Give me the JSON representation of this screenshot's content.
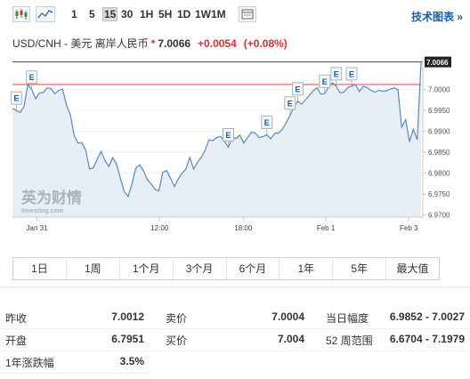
{
  "toolbar": {
    "periods": [
      "1",
      "5",
      "15",
      "30",
      "1H",
      "5H",
      "1D",
      "1W",
      "1M"
    ],
    "active_period": "15",
    "tech_link": "技术图表 »"
  },
  "quote": {
    "symbol": "USD/CNH - 美元 离岸人民币",
    "star": "*",
    "price": "7.0066",
    "change": "+0.0054",
    "change_pct": "(+0.08%)"
  },
  "chart_data": {
    "type": "area",
    "title": "",
    "xlabel": "",
    "ylabel": "",
    "x_ticks": [
      "Jan 31",
      "12:00",
      "18:00",
      "Feb 1",
      "Feb 3"
    ],
    "y_ticks": [
      "7.0066",
      "7.0000",
      "6.9950",
      "6.9900",
      "6.9850",
      "6.9800",
      "6.9750",
      "6.9700"
    ],
    "ylim": [
      6.9695,
      7.0078
    ],
    "last_price": 7.0066,
    "prev_close": 7.0012,
    "watermark": "英为财情",
    "watermark_sub": "Investing.com",
    "event_marker_label": "E",
    "series": [
      {
        "values": [
          6.9955,
          6.995,
          6.9945,
          6.996,
          7.0012,
          7.0,
          6.9978,
          6.9992,
          6.9993,
          7.0004,
          7.0002,
          6.999,
          6.9998,
          7.0001,
          6.9964,
          6.994,
          6.989,
          6.9872,
          6.9873,
          6.9855,
          6.981,
          6.9813,
          6.9834,
          6.9852,
          6.983,
          6.9816,
          6.9837,
          6.9822,
          6.9788,
          6.9756,
          6.9744,
          6.9774,
          6.9812,
          6.982,
          6.9806,
          6.9784,
          6.9774,
          6.9761,
          6.9758,
          6.9802,
          6.9806,
          6.9788,
          6.9768,
          6.9786,
          6.98,
          6.981,
          6.9838,
          6.981,
          6.9826,
          6.9838,
          6.9855,
          6.988,
          6.9878,
          6.9885,
          6.9888,
          6.9876,
          6.9862,
          6.9884,
          6.9883,
          6.9891,
          6.9872,
          6.9885,
          6.9898,
          6.9896,
          6.9885,
          6.9888,
          6.9892,
          6.9882,
          6.9895,
          6.9896,
          6.9905,
          6.992,
          6.9938,
          6.9958,
          6.9972,
          6.9965,
          6.9975,
          6.9986,
          6.9997,
          7.0004,
          6.9989,
          6.999,
          7.0006,
          7.0016,
          7.0008,
          6.9992,
          6.9994,
          7.0005,
          7.0008,
          7.0012,
          6.9995,
          7.0008,
          7.0005,
          6.9998,
          6.9994,
          6.9998,
          6.9996,
          6.9997,
          7.0001,
          7.0004,
          7.0,
          6.991,
          6.9928,
          6.9875,
          6.9905,
          6.988,
          7.0066
        ]
      }
    ],
    "event_markers": [
      1,
      5,
      56,
      66,
      72,
      74,
      81,
      84,
      88
    ]
  },
  "ranges": [
    "1日",
    "1周",
    "1个月",
    "3个月",
    "6个月",
    "1年",
    "5年",
    "最大值"
  ],
  "stats": {
    "rows": [
      {
        "l1": "昨收",
        "v1": "7.0012",
        "l2": "卖价",
        "v2": "7.0004",
        "l3": "当日幅度",
        "v3": "6.9852 - 7.0027"
      },
      {
        "l1": "开盘",
        "v1": "6.7951",
        "l2": "买价",
        "v2": "7.004",
        "l3": "52 周范围",
        "v3": "6.6704 - 7.1979"
      },
      {
        "l1": "1年涨跌幅",
        "v1": "3.5%",
        "l2": "",
        "v2": "",
        "l3": "",
        "v3": ""
      }
    ]
  }
}
